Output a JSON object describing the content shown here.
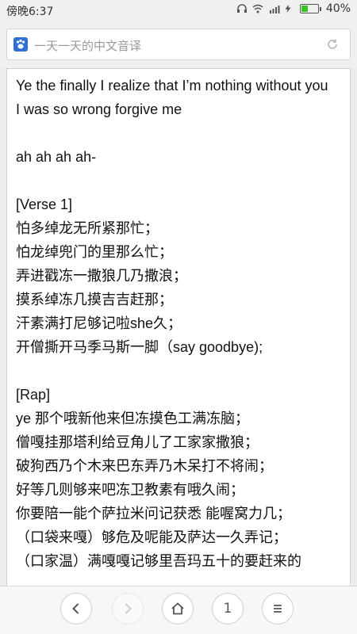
{
  "status": {
    "time": "傍晚6:37",
    "battery": "40%",
    "battery_level": 0.4
  },
  "tab": {
    "title": "一天一天的中文音译"
  },
  "lyrics": {
    "lines": [
      "Ye the finally I realize that I’m nothing without you",
      "I was so wrong forgive me",
      "",
      "ah ah ah ah-",
      "",
      "[Verse 1]",
      "怕多绰龙无所紧那忙；",
      "怕龙绰兜门的里那么忙；",
      "弄进戳冻一撒狼几乃撒浪；",
      "摸系绰冻几摸吉吉赶那；",
      "汗素满打尼够记啦she久；",
      "开僧撕开马季马斯一脚（say goodbye);",
      "",
      "[Rap]",
      "ye 那个哦新他来但冻摸色工满冻脑；",
      "僧嘎挂那塔利给豆角儿了工家家撒狼；",
      "破狗西乃个木来巴东弄乃木呆打不将闹；",
      "好等几则够来吧冻卫教素有哦久闹；",
      "你要陪一能个萨拉米问记获悉 能喔窝力几；",
      "（口袋来嘎）够危及呢能及萨达一久弄记；",
      "（口家温）满嘎嘎记够里吾玛五十的要赶来的"
    ]
  },
  "nav": {
    "tab_count": "1"
  }
}
